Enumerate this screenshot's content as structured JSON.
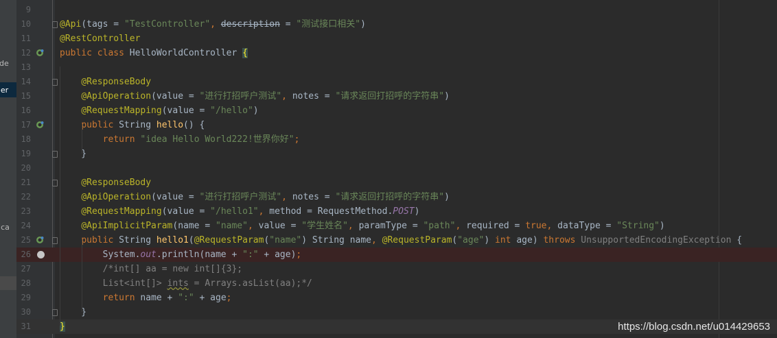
{
  "side_panel": {
    "labels": [
      "otde",
      "oller",
      "plica"
    ]
  },
  "editor": {
    "lines": [
      {
        "n": "9",
        "tokens": []
      },
      {
        "n": "10",
        "tokens": [
          [
            "ann",
            "@Api"
          ],
          [
            "def",
            "(tags = "
          ],
          [
            "str",
            "\"TestController\""
          ],
          [
            "kw",
            ", "
          ],
          [
            "depr",
            "description"
          ],
          [
            "def",
            " = "
          ],
          [
            "str",
            "\"测试接口相关\""
          ],
          [
            "def",
            ")"
          ]
        ]
      },
      {
        "n": "11",
        "tokens": [
          [
            "ann",
            "@RestController"
          ]
        ]
      },
      {
        "n": "12",
        "tokens": [
          [
            "kw",
            "public class "
          ],
          [
            "def",
            "HelloWorldController "
          ],
          [
            "brace",
            "{"
          ]
        ]
      },
      {
        "n": "13",
        "tokens": []
      },
      {
        "n": "14",
        "tokens": [
          [
            "def",
            "    "
          ],
          [
            "ann",
            "@ResponseBody"
          ]
        ]
      },
      {
        "n": "15",
        "tokens": [
          [
            "def",
            "    "
          ],
          [
            "ann",
            "@ApiOperation"
          ],
          [
            "def",
            "(value = "
          ],
          [
            "str",
            "\"进行打招呼户测试\""
          ],
          [
            "kw",
            ", "
          ],
          [
            "def",
            "notes = "
          ],
          [
            "str",
            "\"请求返回打招呼的字符串\""
          ],
          [
            "def",
            ")"
          ]
        ]
      },
      {
        "n": "16",
        "tokens": [
          [
            "def",
            "    "
          ],
          [
            "ann",
            "@RequestMapping"
          ],
          [
            "def",
            "(value = "
          ],
          [
            "str",
            "\"/hello\""
          ],
          [
            "def",
            ")"
          ]
        ]
      },
      {
        "n": "17",
        "tokens": [
          [
            "def",
            "    "
          ],
          [
            "kw",
            "public "
          ],
          [
            "def",
            "String "
          ],
          [
            "fn",
            "hello"
          ],
          [
            "def",
            "() {"
          ]
        ]
      },
      {
        "n": "18",
        "tokens": [
          [
            "def",
            "        "
          ],
          [
            "kw",
            "return "
          ],
          [
            "str",
            "\"idea Hello World222!世界你好\""
          ],
          [
            "kw",
            ";"
          ]
        ]
      },
      {
        "n": "19",
        "tokens": [
          [
            "def",
            "    }"
          ]
        ]
      },
      {
        "n": "20",
        "tokens": []
      },
      {
        "n": "21",
        "tokens": [
          [
            "def",
            "    "
          ],
          [
            "ann",
            "@ResponseBody"
          ]
        ]
      },
      {
        "n": "22",
        "tokens": [
          [
            "def",
            "    "
          ],
          [
            "ann",
            "@ApiOperation"
          ],
          [
            "def",
            "(value = "
          ],
          [
            "str",
            "\"进行打招呼户测试\""
          ],
          [
            "kw",
            ", "
          ],
          [
            "def",
            "notes = "
          ],
          [
            "str",
            "\"请求返回打招呼的字符串\""
          ],
          [
            "def",
            ")"
          ]
        ]
      },
      {
        "n": "23",
        "tokens": [
          [
            "def",
            "    "
          ],
          [
            "ann",
            "@RequestMapping"
          ],
          [
            "def",
            "(value = "
          ],
          [
            "str",
            "\"/hello1\""
          ],
          [
            "kw",
            ", "
          ],
          [
            "def",
            "method = RequestMethod."
          ],
          [
            "sfld",
            "POST"
          ],
          [
            "def",
            ")"
          ]
        ]
      },
      {
        "n": "24",
        "tokens": [
          [
            "def",
            "    "
          ],
          [
            "ann",
            "@ApiImplicitParam"
          ],
          [
            "def",
            "(name = "
          ],
          [
            "str",
            "\"name\""
          ],
          [
            "kw",
            ", "
          ],
          [
            "def",
            "value = "
          ],
          [
            "str",
            "\"学生姓名\""
          ],
          [
            "kw",
            ", "
          ],
          [
            "def",
            "paramType = "
          ],
          [
            "str",
            "\"path\""
          ],
          [
            "kw",
            ", "
          ],
          [
            "def",
            "required = "
          ],
          [
            "kw",
            "true, "
          ],
          [
            "def",
            "dataType = "
          ],
          [
            "str",
            "\"String\""
          ],
          [
            "def",
            ")"
          ]
        ]
      },
      {
        "n": "25",
        "tokens": [
          [
            "def",
            "    "
          ],
          [
            "kw",
            "public "
          ],
          [
            "def",
            "String "
          ],
          [
            "fn",
            "hello1"
          ],
          [
            "def",
            "("
          ],
          [
            "ann",
            "@RequestParam"
          ],
          [
            "def",
            "("
          ],
          [
            "str",
            "\"name\""
          ],
          [
            "def",
            ") String name"
          ],
          [
            "kw",
            ", "
          ],
          [
            "ann",
            "@RequestParam"
          ],
          [
            "def",
            "("
          ],
          [
            "str",
            "\"age\""
          ],
          [
            "def",
            ") "
          ],
          [
            "kw",
            "int "
          ],
          [
            "def",
            "age) "
          ],
          [
            "kw",
            "throws "
          ],
          [
            "cmt",
            "UnsupportedEncodingException "
          ],
          [
            "def",
            "{"
          ]
        ]
      },
      {
        "n": "26",
        "tokens": [
          [
            "def",
            "        System."
          ],
          [
            "sfld",
            "out"
          ],
          [
            "def",
            ".println(name + "
          ],
          [
            "str",
            "\":\""
          ],
          [
            "def",
            " + age)"
          ],
          [
            "kw",
            ";"
          ]
        ]
      },
      {
        "n": "27",
        "tokens": [
          [
            "cmt",
            "        /*int[] aa = new int[]{3};"
          ]
        ]
      },
      {
        "n": "28",
        "tokens": [
          [
            "cmt",
            "        List<int[]> "
          ],
          [
            "warn",
            "ints"
          ],
          [
            "cmt",
            " = Arrays.asList(aa);*/"
          ]
        ]
      },
      {
        "n": "29",
        "tokens": [
          [
            "def",
            "        "
          ],
          [
            "kw",
            "return "
          ],
          [
            "def",
            "name + "
          ],
          [
            "str",
            "\":\""
          ],
          [
            "def",
            " + age"
          ],
          [
            "kw",
            ";"
          ]
        ]
      },
      {
        "n": "30",
        "tokens": [
          [
            "def",
            "    }"
          ]
        ]
      },
      {
        "n": "31",
        "tokens": [
          [
            "brace",
            "}"
          ]
        ]
      }
    ]
  },
  "gutter_icons": {
    "12": "spring-bean-icon",
    "17": "spring-bean-icon",
    "25": "spring-bean-icon",
    "26": "breakpoint-icon"
  },
  "folds": [
    "10",
    "14",
    "19",
    "21",
    "25",
    "30"
  ],
  "watermark": "https://blog.csdn.net/u014429653",
  "colors": {
    "background": "#2b2b2b",
    "annotation": "#bbb529",
    "keyword": "#cc7832",
    "string": "#6a8759",
    "comment": "#808080"
  }
}
